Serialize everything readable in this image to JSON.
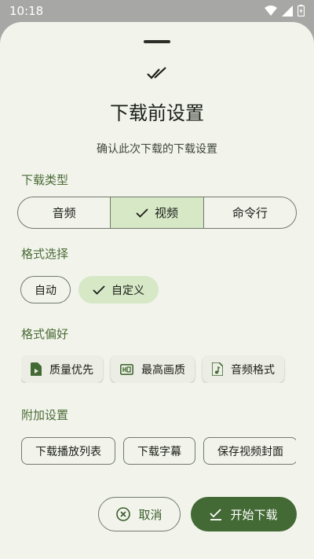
{
  "status_bar": {
    "time": "10:18",
    "icons": [
      "wifi-icon",
      "signal-icon",
      "battery-icon"
    ]
  },
  "sheet": {
    "title": "下载前设置",
    "subtitle": "确认此次下载的下载设置",
    "download_type": {
      "label": "下载类型",
      "options": [
        "音频",
        "视频",
        "命令行"
      ],
      "selected": "视频"
    },
    "format_selection": {
      "label": "格式选择",
      "options": [
        "自动",
        "自定义"
      ],
      "selected": "自定义"
    },
    "format_preference": {
      "label": "格式偏好",
      "options": [
        {
          "label": "质量优先",
          "icon": "file-video-icon"
        },
        {
          "label": "最高画质",
          "icon": "hq-icon"
        },
        {
          "label": "音频格式",
          "icon": "audio-file-icon"
        }
      ]
    },
    "additional_settings": {
      "label": "附加设置",
      "options": [
        "下载播放列表",
        "下载字幕",
        "保存视频封面"
      ]
    },
    "actions": {
      "cancel": "取消",
      "start": "开始下载"
    }
  },
  "colors": {
    "accent": "#436a35",
    "selected_bg": "#d6e8c6",
    "sheet_bg": "#f2f4ec",
    "label_green": "#4b6b36"
  }
}
